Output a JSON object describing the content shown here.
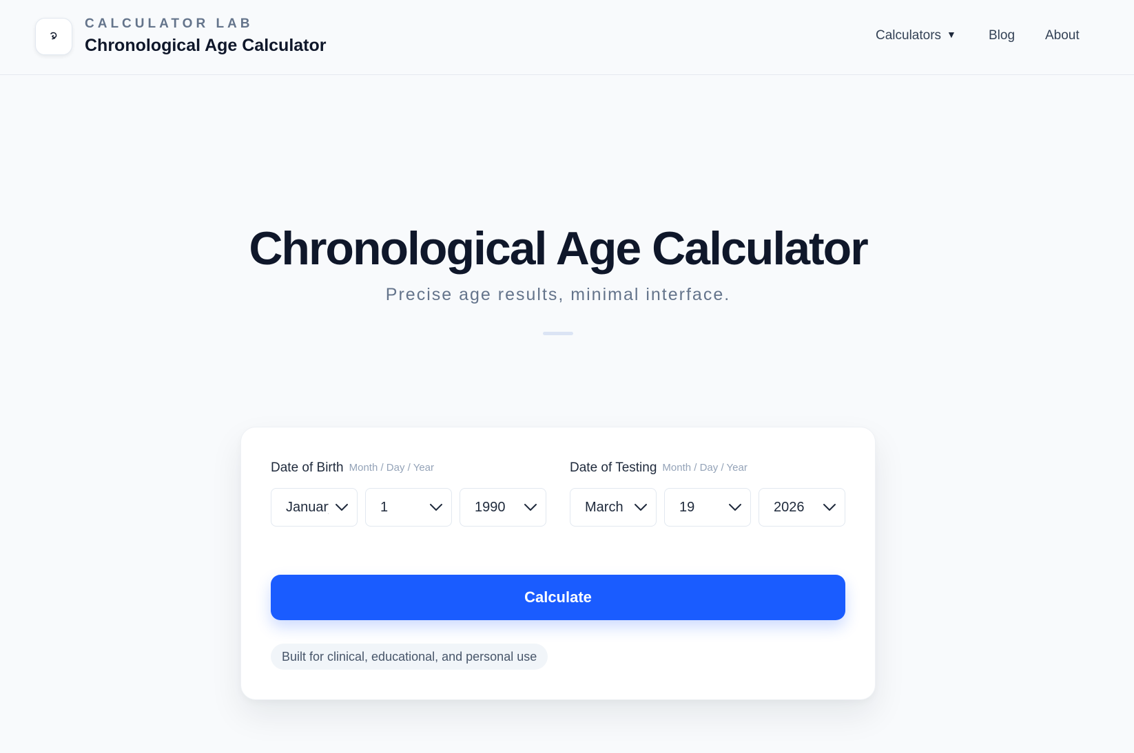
{
  "header": {
    "eyebrow": "CALCULATOR LAB",
    "title": "Chronological Age Calculator",
    "nav": {
      "calculators": "Calculators",
      "blog": "Blog",
      "about": "About"
    }
  },
  "hero": {
    "title": "Chronological Age Calculator",
    "subtitle": "Precise age results, minimal interface."
  },
  "form": {
    "birth": {
      "label": "Date of Birth",
      "hint": "Month / Day / Year",
      "month": "January",
      "day": "1",
      "year": "1990"
    },
    "testing": {
      "label": "Date of Testing",
      "hint": "Month / Day / Year",
      "month": "March",
      "day": "19",
      "year": "2026"
    },
    "calculate_label": "Calculate",
    "note": "Built for clinical, educational, and personal use"
  },
  "colors": {
    "accent": "#1a5cff",
    "background": "#f8fafc",
    "text": "#0f172a",
    "muted": "#64748b"
  },
  "icons": {
    "logo": "spiral-icon",
    "nav_caret": "caret-down-icon",
    "select_chevron": "chevron-down-icon"
  }
}
